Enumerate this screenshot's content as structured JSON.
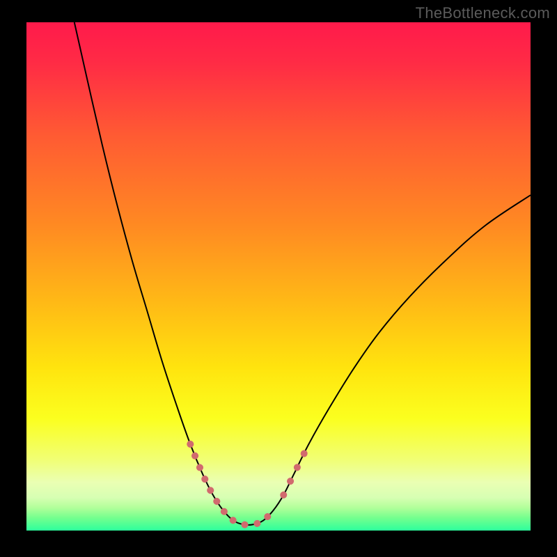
{
  "watermark": "TheBottleneck.com",
  "chart_data": {
    "type": "line",
    "title": "",
    "xlabel": "",
    "ylabel": "",
    "xlim": [
      0,
      100
    ],
    "ylim": [
      0,
      100
    ],
    "grid": false,
    "background_gradient_stops": [
      {
        "offset": 0.0,
        "color": "#ff1a4b"
      },
      {
        "offset": 0.08,
        "color": "#ff2b45"
      },
      {
        "offset": 0.22,
        "color": "#ff5a33"
      },
      {
        "offset": 0.4,
        "color": "#ff8a22"
      },
      {
        "offset": 0.55,
        "color": "#ffb916"
      },
      {
        "offset": 0.68,
        "color": "#ffe40e"
      },
      {
        "offset": 0.78,
        "color": "#fbff1f"
      },
      {
        "offset": 0.86,
        "color": "#f1ff74"
      },
      {
        "offset": 0.905,
        "color": "#eaffb3"
      },
      {
        "offset": 0.935,
        "color": "#d7ffb3"
      },
      {
        "offset": 0.955,
        "color": "#b2ff9a"
      },
      {
        "offset": 0.975,
        "color": "#74ff8e"
      },
      {
        "offset": 1.0,
        "color": "#2dff9c"
      }
    ],
    "series": [
      {
        "name": "bottleneck-curve",
        "stroke": "#000000",
        "stroke_width": 2,
        "data": [
          {
            "x": 9.5,
            "y": 100.0
          },
          {
            "x": 12.0,
            "y": 89.0
          },
          {
            "x": 15.0,
            "y": 76.0
          },
          {
            "x": 18.0,
            "y": 64.0
          },
          {
            "x": 21.0,
            "y": 53.0
          },
          {
            "x": 24.0,
            "y": 43.0
          },
          {
            "x": 27.0,
            "y": 33.0
          },
          {
            "x": 30.0,
            "y": 24.0
          },
          {
            "x": 32.5,
            "y": 17.0
          },
          {
            "x": 35.0,
            "y": 11.0
          },
          {
            "x": 37.0,
            "y": 7.0
          },
          {
            "x": 39.0,
            "y": 4.0
          },
          {
            "x": 41.0,
            "y": 2.0
          },
          {
            "x": 43.0,
            "y": 1.2
          },
          {
            "x": 45.0,
            "y": 1.2
          },
          {
            "x": 47.0,
            "y": 2.0
          },
          {
            "x": 49.0,
            "y": 4.0
          },
          {
            "x": 51.0,
            "y": 7.0
          },
          {
            "x": 53.0,
            "y": 11.0
          },
          {
            "x": 56.0,
            "y": 17.0
          },
          {
            "x": 60.0,
            "y": 24.0
          },
          {
            "x": 65.0,
            "y": 32.0
          },
          {
            "x": 70.0,
            "y": 39.0
          },
          {
            "x": 76.0,
            "y": 46.0
          },
          {
            "x": 83.0,
            "y": 53.0
          },
          {
            "x": 91.0,
            "y": 60.0
          },
          {
            "x": 100.0,
            "y": 66.0
          }
        ]
      },
      {
        "name": "highlight-left",
        "stroke": "#d16a6e",
        "stroke_width": 10,
        "stroke_linecap": "round",
        "dash": "0.1 18",
        "data": [
          {
            "x": 32.5,
            "y": 17.0
          },
          {
            "x": 35.0,
            "y": 11.0
          },
          {
            "x": 37.0,
            "y": 7.0
          },
          {
            "x": 39.0,
            "y": 4.0
          },
          {
            "x": 41.0,
            "y": 2.0
          },
          {
            "x": 43.0,
            "y": 1.2
          },
          {
            "x": 45.0,
            "y": 1.2
          },
          {
            "x": 47.0,
            "y": 2.0
          },
          {
            "x": 49.0,
            "y": 4.0
          }
        ]
      },
      {
        "name": "highlight-right",
        "stroke": "#d16a6e",
        "stroke_width": 10,
        "stroke_linecap": "round",
        "dash": "0.1 22",
        "data": [
          {
            "x": 51.0,
            "y": 7.0
          },
          {
            "x": 53.0,
            "y": 11.0
          },
          {
            "x": 56.0,
            "y": 17.0
          }
        ]
      }
    ]
  }
}
